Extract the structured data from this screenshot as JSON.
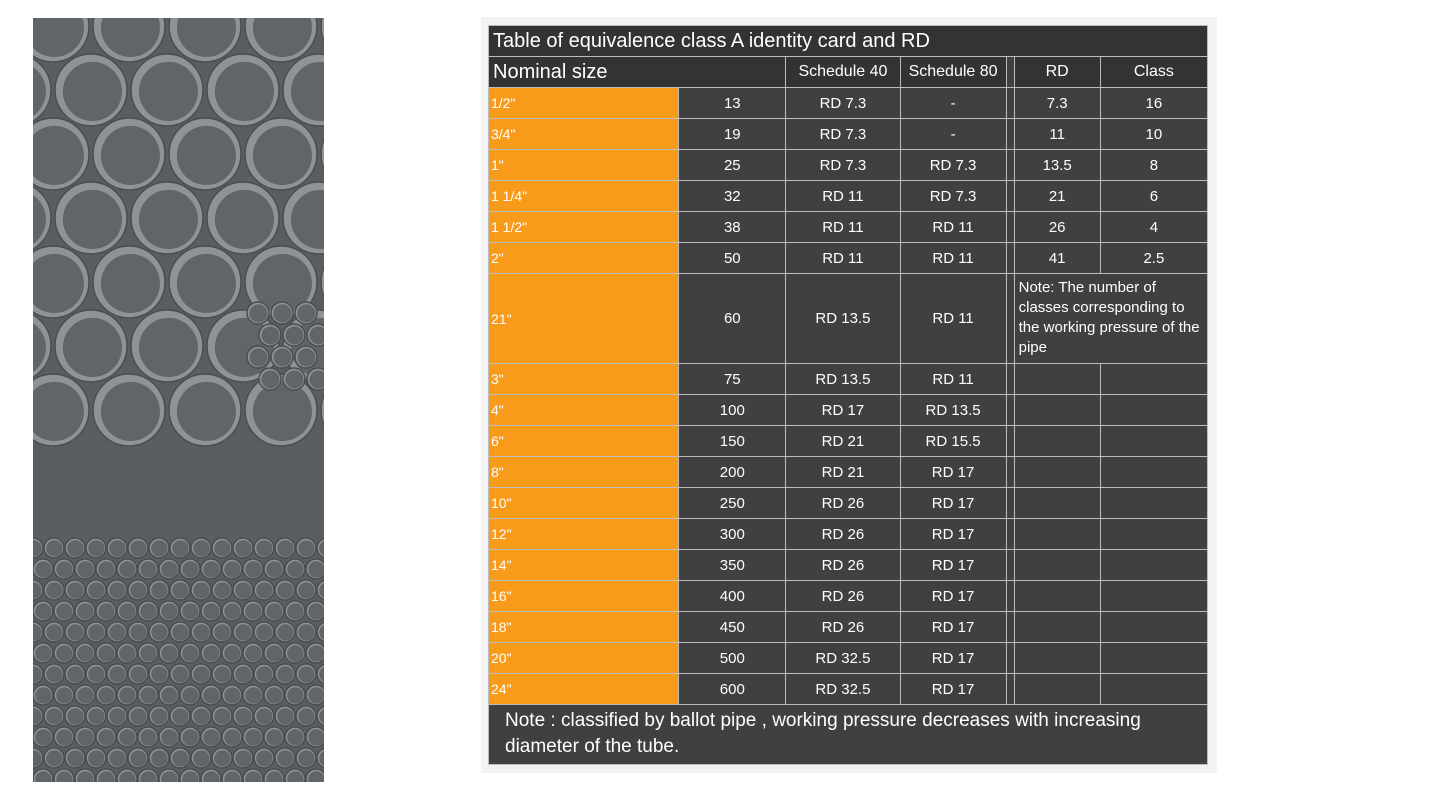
{
  "table": {
    "title": "Table of equivalence class  A identity card and RD",
    "headers": {
      "nominal_size": "Nominal size",
      "schedule_40": "Schedule 40",
      "schedule_80": "Schedule 80",
      "rd": "RD",
      "class": "Class"
    },
    "rows": [
      {
        "size": "1/2\"",
        "mm": "13",
        "s40": "RD 7.3",
        "s80": "-",
        "rd": "7.3",
        "class": "16"
      },
      {
        "size": "3/4\"",
        "mm": "19",
        "s40": "RD 7.3",
        "s80": "-",
        "rd": "11",
        "class": "10"
      },
      {
        "size": "1\"",
        "mm": "25",
        "s40": "RD 7.3",
        "s80": "RD 7.3",
        "rd": "13.5",
        "class": "8"
      },
      {
        "size": "1 1/4\"",
        "mm": "32",
        "s40": "RD 11",
        "s80": "RD 7.3",
        "rd": "21",
        "class": "6"
      },
      {
        "size": "1 1/2\"",
        "mm": "38",
        "s40": "RD 11",
        "s80": "RD 11",
        "rd": "26",
        "class": "4"
      },
      {
        "size": "2\"",
        "mm": "50",
        "s40": "RD 11",
        "s80": "RD 11",
        "rd": "41",
        "class": "2.5"
      },
      {
        "size": "21\"",
        "mm": "60",
        "s40": "RD 13.5",
        "s80": "RD 11"
      },
      {
        "size": "3\"",
        "mm": "75",
        "s40": "RD 13.5",
        "s80": "RD 11"
      },
      {
        "size": "4\"",
        "mm": "100",
        "s40": "RD 17",
        "s80": "RD 13.5"
      },
      {
        "size": "6\"",
        "mm": "150",
        "s40": "RD 21",
        "s80": "RD 15.5"
      },
      {
        "size": "8\"",
        "mm": "200",
        "s40": "RD 21",
        "s80": "RD 17"
      },
      {
        "size": "10\"",
        "mm": "250",
        "s40": "RD 26",
        "s80": "RD 17"
      },
      {
        "size": "12\"",
        "mm": "300",
        "s40": "RD 26",
        "s80": "RD 17"
      },
      {
        "size": "14\"",
        "mm": "350",
        "s40": "RD 26",
        "s80": "RD 17"
      },
      {
        "size": "16\"",
        "mm": "400",
        "s40": "RD 26",
        "s80": "RD 17"
      },
      {
        "size": "18\"",
        "mm": "450",
        "s40": "RD 26",
        "s80": "RD 17"
      },
      {
        "size": "20\"",
        "mm": "500",
        "s40": "RD 32.5",
        "s80": "RD 17"
      },
      {
        "size": "24\"",
        "mm": "600",
        "s40": "RD 32.5",
        "s80": "RD 17"
      }
    ],
    "side_note": "Note: The number of classes corresponding to the working pressure of the pipe",
    "footer_note": "Note : classified by ballot pipe , working pressure decreases with increasing diameter of the tube."
  },
  "colors": {
    "size_column": "#f89b1a",
    "cell_bg": "#404040",
    "header_bg": "#333333",
    "pipe_gray": "#7e8488"
  }
}
